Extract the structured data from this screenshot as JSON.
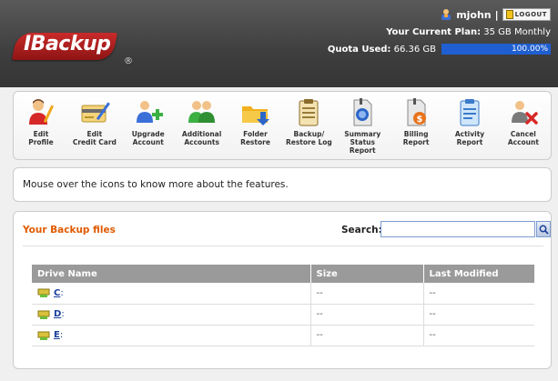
{
  "header": {
    "logo_text": "IBackup",
    "logo_mark": "®",
    "username": "mjohn",
    "separator": "|",
    "logout_label": "LOGOUT",
    "plan_label": "Your Current Plan:",
    "plan_value": "35 GB Monthly",
    "quota_label": "Quota Used:",
    "quota_value": "66.36 GB",
    "quota_percent_text": "100.00%",
    "quota_fraction": 1.0
  },
  "toolbar": {
    "items": [
      {
        "label": "Edit\nProfile",
        "icon": "edit-profile-icon"
      },
      {
        "label": "Edit\nCredit Card",
        "icon": "credit-card-icon"
      },
      {
        "label": "Upgrade\nAccount",
        "icon": "upgrade-account-icon"
      },
      {
        "label": "Additional\nAccounts",
        "icon": "additional-accounts-icon"
      },
      {
        "label": "Folder\nRestore",
        "icon": "folder-restore-icon"
      },
      {
        "label": "Backup/\nRestore Log",
        "icon": "backup-log-icon"
      },
      {
        "label": "Summary\nStatus Report",
        "icon": "summary-report-icon"
      },
      {
        "label": "Billing\nReport",
        "icon": "billing-report-icon"
      },
      {
        "label": "Activity\nReport",
        "icon": "activity-report-icon"
      },
      {
        "label": "Cancel\nAccount",
        "icon": "cancel-account-icon"
      }
    ]
  },
  "info": {
    "text": "Mouse over the icons to know more about the features."
  },
  "files": {
    "title": "Your Backup files",
    "search_label": "Search:",
    "search_value": "",
    "columns": [
      "Drive Name",
      "Size",
      "Last Modified"
    ],
    "rows": [
      {
        "drive": "C",
        "size": "--",
        "modified": "--"
      },
      {
        "drive": "D",
        "size": "--",
        "modified": "--"
      },
      {
        "drive": "E",
        "size": "--",
        "modified": "--"
      }
    ]
  },
  "colors": {
    "header_bg": "#3e3e3e",
    "logo_red": "#c92a2a",
    "accent_orange": "#e05a00",
    "quota_blue": "#1f5fd1",
    "table_header": "#9a9a9a",
    "link_blue": "#1a3e9c"
  }
}
